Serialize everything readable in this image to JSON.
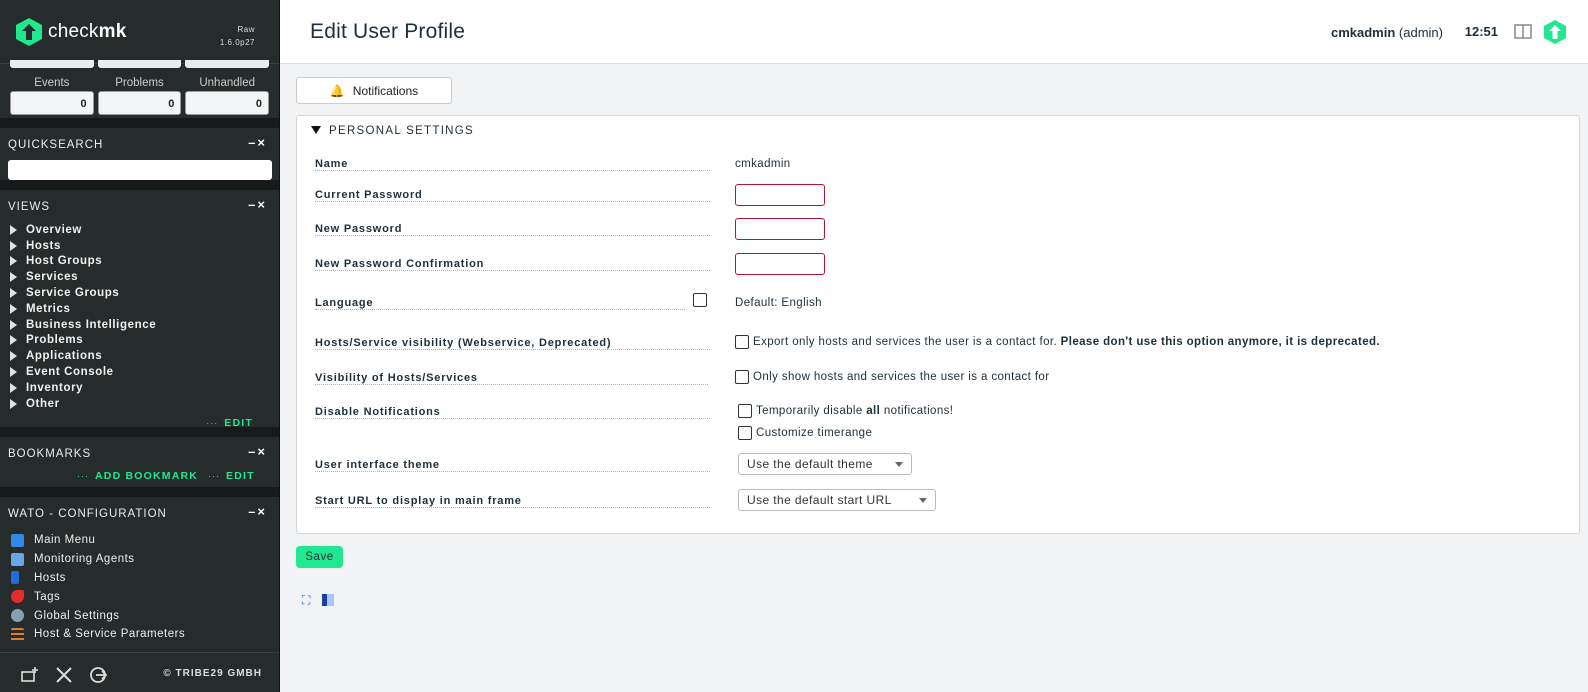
{
  "brand": {
    "name_light": "check",
    "name_bold": "mk",
    "edition": "Raw",
    "version": "1.6.0p27",
    "color": "#1fe88f"
  },
  "stats": {
    "labels": [
      "Events",
      "Problems",
      "Unhandled"
    ],
    "values": [
      "0",
      "0",
      "0"
    ]
  },
  "quicksearch": {
    "title": "QUICKSEARCH",
    "controls": "–×"
  },
  "views": {
    "title": "VIEWS",
    "controls": "–×",
    "items": [
      "Overview",
      "Hosts",
      "Host Groups",
      "Services",
      "Service Groups",
      "Metrics",
      "Business Intelligence",
      "Problems",
      "Applications",
      "Event Console",
      "Inventory",
      "Other"
    ],
    "edit_dots": "···",
    "edit_label": "EDIT"
  },
  "bookmarks": {
    "title": "BOOKMARKS",
    "controls": "–×",
    "dots": "···",
    "add_label": "ADD BOOKMARK",
    "edit_label": "EDIT"
  },
  "wato": {
    "title": "WATO - CONFIGURATION",
    "controls": "–×",
    "items": [
      {
        "label": "Main Menu",
        "icon": "main-menu-icon",
        "color": "#2e8ae6"
      },
      {
        "label": "Monitoring Agents",
        "icon": "agents-icon",
        "color": "#6aa7e8"
      },
      {
        "label": "Hosts",
        "icon": "hosts-icon",
        "color": "#1e6fd9"
      },
      {
        "label": "Tags",
        "icon": "tags-icon",
        "color": "#e22d2d"
      },
      {
        "label": "Global Settings",
        "icon": "gear-icon",
        "color": "#8aa0b0"
      },
      {
        "label": "Host & Service Parameters",
        "icon": "parameters-icon",
        "color": "#e07b2a"
      }
    ]
  },
  "footer": {
    "copyright": "© TRIBE29 GMBH"
  },
  "header": {
    "title": "Edit User Profile",
    "username": "cmkadmin",
    "role": "(admin)",
    "time": "12:51"
  },
  "tabs": {
    "notifications": "Notifications"
  },
  "form": {
    "section_title": "PERSONAL SETTINGS",
    "name_label": "Name",
    "name_value": "cmkadmin",
    "current_password_label": "Current Password",
    "new_password_label": "New Password",
    "new_password_confirm_label": "New Password Confirmation",
    "language_label": "Language",
    "language_value": "Default: English",
    "webservice_label": "Hosts/Service visibility (Webservice, Deprecated)",
    "webservice_text": "Export only hosts and services the user is a contact for.",
    "webservice_warning": "Please don't use this option anymore, it is deprecated.",
    "visibility_label": "Visibility of Hosts/Services",
    "visibility_text": "Only show hosts and services the user is a contact for",
    "disable_notif_label": "Disable Notifications",
    "disable_notif_text_pre": "Temporarily disable ",
    "disable_notif_text_bold": "all",
    "disable_notif_text_post": " notifications!",
    "customize_timerange_text": "Customize timerange",
    "theme_label": "User interface theme",
    "theme_value": "Use the default theme",
    "start_url_label": "Start URL to display in main frame",
    "start_url_value": "Use the default start URL"
  },
  "save_label": "Save"
}
